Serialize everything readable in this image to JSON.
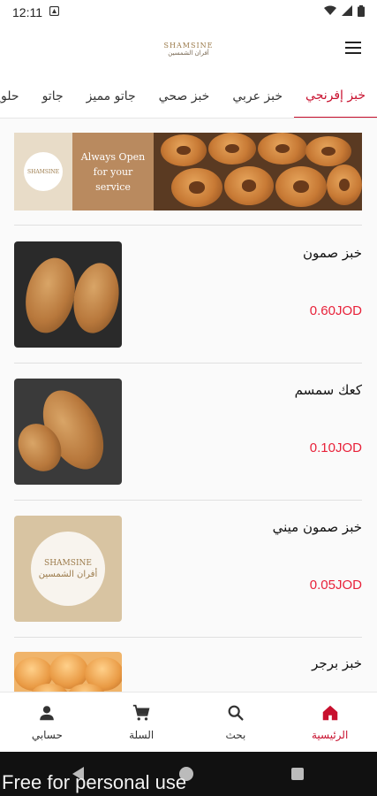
{
  "status_bar": {
    "time": "12:11"
  },
  "header": {
    "logo_en": "SHAMSINE",
    "logo_ar": "أفران الشمسين"
  },
  "categories": [
    {
      "label": "خبز إفرنجي",
      "active": true
    },
    {
      "label": "خبز عربي",
      "active": false
    },
    {
      "label": "خبز صحي",
      "active": false
    },
    {
      "label": "جاتو مميز",
      "active": false
    },
    {
      "label": "جاتو",
      "active": false
    },
    {
      "label": "حلويات",
      "active": false
    }
  ],
  "banner": {
    "logo_text": "SHAMSINE",
    "text": "Always Open for your service"
  },
  "products": [
    {
      "name": "خبز صمون",
      "price": "0.60JOD"
    },
    {
      "name": "كعك سمسم",
      "price": "0.10JOD"
    },
    {
      "name": "خبز صمون ميني",
      "price": "0.05JOD",
      "thumb_en": "SHAMSINE",
      "thumb_ar": "أفران الشمسين"
    },
    {
      "name": "خبز برجر",
      "price": ""
    }
  ],
  "bottom_nav": [
    {
      "label": "الرئيسية",
      "icon": "home-icon",
      "active": true
    },
    {
      "label": "بحث",
      "icon": "search-icon",
      "active": false
    },
    {
      "label": "السلة",
      "icon": "cart-icon",
      "active": false
    },
    {
      "label": "حسابي",
      "icon": "person-icon",
      "active": false
    }
  ],
  "watermark": "Free for personal use",
  "colors": {
    "accent": "#c8102e",
    "price": "#e8223a",
    "banner_tan": "#b98a5f"
  }
}
